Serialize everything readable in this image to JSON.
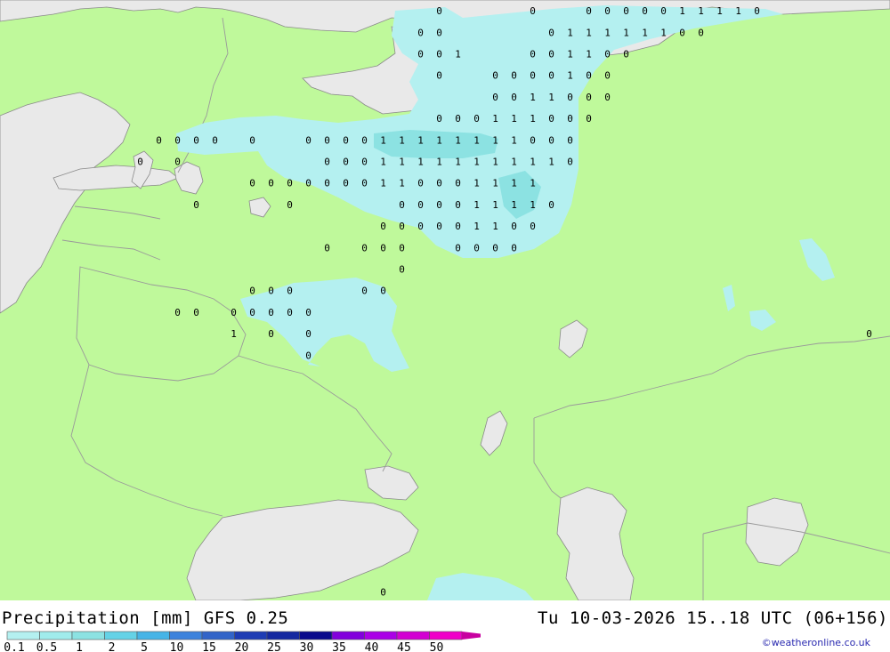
{
  "title": "Precipitation [mm] GFS 0.25",
  "valid_time": "Tu 10-03-2026 15..18 UTC (06+156)",
  "credit": "©weatheronline.co.uk",
  "colors": {
    "land": "#bff99b",
    "sea": "#e9e9e9",
    "border": "#9a9a9a",
    "coast": "#8a8a8a"
  },
  "legend": {
    "levels": [
      "0.1",
      "0.5",
      "1",
      "2",
      "5",
      "10",
      "15",
      "20",
      "25",
      "30",
      "35",
      "40",
      "45",
      "50"
    ],
    "colors": [
      "#b4f0f0",
      "#a0ecec",
      "#8ce2e2",
      "#64d2e6",
      "#46b4e6",
      "#3c82dc",
      "#3264c8",
      "#1e3cb4",
      "#1428a0",
      "#0a0a8c",
      "#8200dc",
      "#aa00e6",
      "#d200d2",
      "#f000c8",
      "#c800a0"
    ]
  },
  "grid_values": [
    {
      "v": "0",
      "lon": 37.5,
      "lat": 69.5
    },
    {
      "v": "0",
      "lon": 42.5,
      "lat": 69.5
    },
    {
      "v": "0",
      "lon": 45.5,
      "lat": 69.5
    },
    {
      "v": "0",
      "lon": 46.5,
      "lat": 69.5
    },
    {
      "v": "0",
      "lon": 47.5,
      "lat": 69.5
    },
    {
      "v": "0",
      "lon": 48.5,
      "lat": 69.5
    },
    {
      "v": "0",
      "lon": 49.5,
      "lat": 69.5
    },
    {
      "v": "1",
      "lon": 50.5,
      "lat": 69.5
    },
    {
      "v": "1",
      "lon": 51.5,
      "lat": 69.5
    },
    {
      "v": "1",
      "lon": 52.5,
      "lat": 69.5
    },
    {
      "v": "1",
      "lon": 53.5,
      "lat": 69.5
    },
    {
      "v": "0",
      "lon": 54.5,
      "lat": 69.5
    },
    {
      "v": "0",
      "lon": 36.5,
      "lat": 68.5
    },
    {
      "v": "0",
      "lon": 37.5,
      "lat": 68.5
    },
    {
      "v": "0",
      "lon": 43.5,
      "lat": 68.5
    },
    {
      "v": "1",
      "lon": 44.5,
      "lat": 68.5
    },
    {
      "v": "1",
      "lon": 45.5,
      "lat": 68.5
    },
    {
      "v": "1",
      "lon": 46.5,
      "lat": 68.5
    },
    {
      "v": "1",
      "lon": 47.5,
      "lat": 68.5
    },
    {
      "v": "1",
      "lon": 48.5,
      "lat": 68.5
    },
    {
      "v": "1",
      "lon": 49.5,
      "lat": 68.5
    },
    {
      "v": "0",
      "lon": 50.5,
      "lat": 68.5
    },
    {
      "v": "0",
      "lon": 51.5,
      "lat": 68.5
    },
    {
      "v": "0",
      "lon": 36.5,
      "lat": 67.5
    },
    {
      "v": "0",
      "lon": 37.5,
      "lat": 67.5
    },
    {
      "v": "1",
      "lon": 38.5,
      "lat": 67.5
    },
    {
      "v": "0",
      "lon": 42.5,
      "lat": 67.5
    },
    {
      "v": "0",
      "lon": 43.5,
      "lat": 67.5
    },
    {
      "v": "1",
      "lon": 44.5,
      "lat": 67.5
    },
    {
      "v": "1",
      "lon": 45.5,
      "lat": 67.5
    },
    {
      "v": "0",
      "lon": 46.5,
      "lat": 67.5
    },
    {
      "v": "0",
      "lon": 47.5,
      "lat": 67.5
    },
    {
      "v": "0",
      "lon": 37.5,
      "lat": 66.5
    },
    {
      "v": "0",
      "lon": 40.5,
      "lat": 66.5
    },
    {
      "v": "0",
      "lon": 41.5,
      "lat": 66.5
    },
    {
      "v": "0",
      "lon": 42.5,
      "lat": 66.5
    },
    {
      "v": "0",
      "lon": 43.5,
      "lat": 66.5
    },
    {
      "v": "1",
      "lon": 44.5,
      "lat": 66.5
    },
    {
      "v": "0",
      "lon": 45.5,
      "lat": 66.5
    },
    {
      "v": "0",
      "lon": 46.5,
      "lat": 66.5
    },
    {
      "v": "0",
      "lon": 40.5,
      "lat": 65.5
    },
    {
      "v": "0",
      "lon": 41.5,
      "lat": 65.5
    },
    {
      "v": "1",
      "lon": 42.5,
      "lat": 65.5
    },
    {
      "v": "1",
      "lon": 43.5,
      "lat": 65.5
    },
    {
      "v": "0",
      "lon": 44.5,
      "lat": 65.5
    },
    {
      "v": "0",
      "lon": 45.5,
      "lat": 65.5
    },
    {
      "v": "0",
      "lon": 46.5,
      "lat": 65.5
    },
    {
      "v": "0",
      "lon": 37.5,
      "lat": 64.5
    },
    {
      "v": "0",
      "lon": 38.5,
      "lat": 64.5
    },
    {
      "v": "0",
      "lon": 39.5,
      "lat": 64.5
    },
    {
      "v": "1",
      "lon": 40.5,
      "lat": 64.5
    },
    {
      "v": "1",
      "lon": 41.5,
      "lat": 64.5
    },
    {
      "v": "1",
      "lon": 42.5,
      "lat": 64.5
    },
    {
      "v": "0",
      "lon": 43.5,
      "lat": 64.5
    },
    {
      "v": "0",
      "lon": 44.5,
      "lat": 64.5
    },
    {
      "v": "0",
      "lon": 45.5,
      "lat": 64.5
    },
    {
      "v": "0",
      "lon": 22.5,
      "lat": 63.5
    },
    {
      "v": "0",
      "lon": 23.5,
      "lat": 63.5
    },
    {
      "v": "0",
      "lon": 24.5,
      "lat": 63.5
    },
    {
      "v": "0",
      "lon": 25.5,
      "lat": 63.5
    },
    {
      "v": "0",
      "lon": 27.5,
      "lat": 63.5
    },
    {
      "v": "0",
      "lon": 30.5,
      "lat": 63.5
    },
    {
      "v": "0",
      "lon": 31.5,
      "lat": 63.5
    },
    {
      "v": "0",
      "lon": 32.5,
      "lat": 63.5
    },
    {
      "v": "0",
      "lon": 33.5,
      "lat": 63.5
    },
    {
      "v": "1",
      "lon": 34.5,
      "lat": 63.5
    },
    {
      "v": "1",
      "lon": 35.5,
      "lat": 63.5
    },
    {
      "v": "1",
      "lon": 36.5,
      "lat": 63.5
    },
    {
      "v": "1",
      "lon": 37.5,
      "lat": 63.5
    },
    {
      "v": "1",
      "lon": 38.5,
      "lat": 63.5
    },
    {
      "v": "1",
      "lon": 39.5,
      "lat": 63.5
    },
    {
      "v": "1",
      "lon": 40.5,
      "lat": 63.5
    },
    {
      "v": "1",
      "lon": 41.5,
      "lat": 63.5
    },
    {
      "v": "0",
      "lon": 42.5,
      "lat": 63.5
    },
    {
      "v": "0",
      "lon": 43.5,
      "lat": 63.5
    },
    {
      "v": "0",
      "lon": 44.5,
      "lat": 63.5
    },
    {
      "v": "0",
      "lon": 21.5,
      "lat": 62.5
    },
    {
      "v": "0",
      "lon": 23.5,
      "lat": 62.5
    },
    {
      "v": "0",
      "lon": 31.5,
      "lat": 62.5
    },
    {
      "v": "0",
      "lon": 32.5,
      "lat": 62.5
    },
    {
      "v": "0",
      "lon": 33.5,
      "lat": 62.5
    },
    {
      "v": "1",
      "lon": 34.5,
      "lat": 62.5
    },
    {
      "v": "1",
      "lon": 35.5,
      "lat": 62.5
    },
    {
      "v": "1",
      "lon": 36.5,
      "lat": 62.5
    },
    {
      "v": "1",
      "lon": 37.5,
      "lat": 62.5
    },
    {
      "v": "1",
      "lon": 38.5,
      "lat": 62.5
    },
    {
      "v": "1",
      "lon": 39.5,
      "lat": 62.5
    },
    {
      "v": "1",
      "lon": 40.5,
      "lat": 62.5
    },
    {
      "v": "1",
      "lon": 41.5,
      "lat": 62.5
    },
    {
      "v": "1",
      "lon": 42.5,
      "lat": 62.5
    },
    {
      "v": "1",
      "lon": 43.5,
      "lat": 62.5
    },
    {
      "v": "0",
      "lon": 44.5,
      "lat": 62.5
    },
    {
      "v": "0",
      "lon": 27.5,
      "lat": 61.5
    },
    {
      "v": "0",
      "lon": 28.5,
      "lat": 61.5
    },
    {
      "v": "0",
      "lon": 29.5,
      "lat": 61.5
    },
    {
      "v": "0",
      "lon": 30.5,
      "lat": 61.5
    },
    {
      "v": "0",
      "lon": 31.5,
      "lat": 61.5
    },
    {
      "v": "0",
      "lon": 32.5,
      "lat": 61.5
    },
    {
      "v": "0",
      "lon": 33.5,
      "lat": 61.5
    },
    {
      "v": "1",
      "lon": 34.5,
      "lat": 61.5
    },
    {
      "v": "1",
      "lon": 35.5,
      "lat": 61.5
    },
    {
      "v": "0",
      "lon": 36.5,
      "lat": 61.5
    },
    {
      "v": "0",
      "lon": 37.5,
      "lat": 61.5
    },
    {
      "v": "0",
      "lon": 38.5,
      "lat": 61.5
    },
    {
      "v": "1",
      "lon": 39.5,
      "lat": 61.5
    },
    {
      "v": "1",
      "lon": 40.5,
      "lat": 61.5
    },
    {
      "v": "1",
      "lon": 41.5,
      "lat": 61.5
    },
    {
      "v": "1",
      "lon": 42.5,
      "lat": 61.5
    },
    {
      "v": "0",
      "lon": 24.5,
      "lat": 60.5
    },
    {
      "v": "0",
      "lon": 29.5,
      "lat": 60.5
    },
    {
      "v": "0",
      "lon": 35.5,
      "lat": 60.5
    },
    {
      "v": "0",
      "lon": 36.5,
      "lat": 60.5
    },
    {
      "v": "0",
      "lon": 37.5,
      "lat": 60.5
    },
    {
      "v": "0",
      "lon": 38.5,
      "lat": 60.5
    },
    {
      "v": "1",
      "lon": 39.5,
      "lat": 60.5
    },
    {
      "v": "1",
      "lon": 40.5,
      "lat": 60.5
    },
    {
      "v": "1",
      "lon": 41.5,
      "lat": 60.5
    },
    {
      "v": "1",
      "lon": 42.5,
      "lat": 60.5
    },
    {
      "v": "0",
      "lon": 43.5,
      "lat": 60.5
    },
    {
      "v": "0",
      "lon": 34.5,
      "lat": 59.5
    },
    {
      "v": "0",
      "lon": 35.5,
      "lat": 59.5
    },
    {
      "v": "0",
      "lon": 36.5,
      "lat": 59.5
    },
    {
      "v": "0",
      "lon": 37.5,
      "lat": 59.5
    },
    {
      "v": "0",
      "lon": 38.5,
      "lat": 59.5
    },
    {
      "v": "1",
      "lon": 39.5,
      "lat": 59.5
    },
    {
      "v": "1",
      "lon": 40.5,
      "lat": 59.5
    },
    {
      "v": "0",
      "lon": 41.5,
      "lat": 59.5
    },
    {
      "v": "0",
      "lon": 42.5,
      "lat": 59.5
    },
    {
      "v": "0",
      "lon": 31.5,
      "lat": 58.5
    },
    {
      "v": "0",
      "lon": 33.5,
      "lat": 58.5
    },
    {
      "v": "0",
      "lon": 34.5,
      "lat": 58.5
    },
    {
      "v": "0",
      "lon": 35.5,
      "lat": 58.5
    },
    {
      "v": "0",
      "lon": 38.5,
      "lat": 58.5
    },
    {
      "v": "0",
      "lon": 39.5,
      "lat": 58.5
    },
    {
      "v": "0",
      "lon": 40.5,
      "lat": 58.5
    },
    {
      "v": "0",
      "lon": 41.5,
      "lat": 58.5
    },
    {
      "v": "0",
      "lon": 35.5,
      "lat": 57.5
    },
    {
      "v": "0",
      "lon": 64.5,
      "lat": 57.5
    },
    {
      "v": "0",
      "lon": 27.5,
      "lat": 56.5
    },
    {
      "v": "0",
      "lon": 28.5,
      "lat": 56.5
    },
    {
      "v": "0",
      "lon": 29.5,
      "lat": 56.5
    },
    {
      "v": "0",
      "lon": 33.5,
      "lat": 56.5
    },
    {
      "v": "0",
      "lon": 34.5,
      "lat": 56.5
    },
    {
      "v": "0",
      "lon": 23.5,
      "lat": 55.5
    },
    {
      "v": "0",
      "lon": 24.5,
      "lat": 55.5
    },
    {
      "v": "0",
      "lon": 26.5,
      "lat": 55.5
    },
    {
      "v": "0",
      "lon": 27.5,
      "lat": 55.5
    },
    {
      "v": "0",
      "lon": 28.5,
      "lat": 55.5
    },
    {
      "v": "0",
      "lon": 29.5,
      "lat": 55.5
    },
    {
      "v": "0",
      "lon": 30.5,
      "lat": 55.5
    },
    {
      "v": "1",
      "lon": 26.5,
      "lat": 54.5
    },
    {
      "v": "0",
      "lon": 28.5,
      "lat": 54.5
    },
    {
      "v": "0",
      "lon": 30.5,
      "lat": 54.5
    },
    {
      "v": "0",
      "lon": 60.5,
      "lat": 54.5
    },
    {
      "v": "0",
      "lon": 30.5,
      "lat": 53.5
    },
    {
      "v": "0",
      "lon": 71.5,
      "lat": 52.5
    },
    {
      "v": "0",
      "lon": 34.5,
      "lat": 42.5
    },
    {
      "v": "0",
      "lon": 33.5,
      "lat": 41.5
    },
    {
      "v": "0",
      "lon": 35.5,
      "lat": 41.5
    },
    {
      "v": "0",
      "lon": 38.5,
      "lat": 41.5
    }
  ]
}
